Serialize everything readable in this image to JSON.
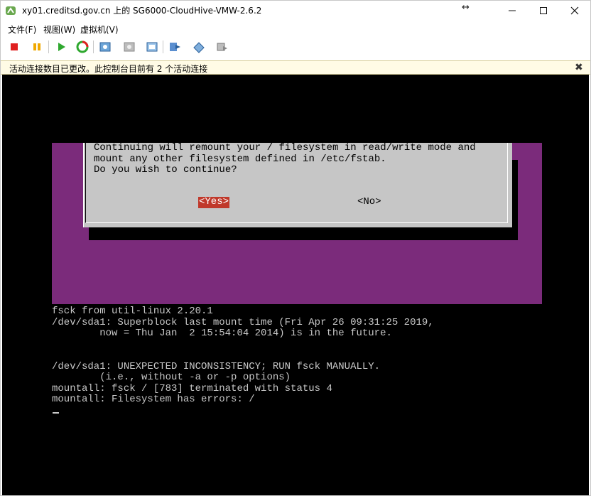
{
  "window": {
    "title": "xy01.creditsd.gov.cn 上的 SG6000-CloudHive-VMW-2.6.2",
    "resize_symbol": "↔",
    "min_symbol": "—",
    "max_symbol": "☐",
    "close_symbol": "✕"
  },
  "menu": {
    "items": [
      "文件(F)",
      "视图(W)",
      "虚拟机(V)"
    ]
  },
  "toolbar": {
    "icons": [
      "stop-icon",
      "pause-icon",
      "play-icon",
      "reset-icon",
      "snapshot-icon",
      "revert-snapshot-icon",
      "manage-snapshot-icon",
      "send-ctrl-alt-del-icon",
      "connect-device-icon",
      "settings-icon"
    ]
  },
  "notification": {
    "text": "活动连接数目已更改。此控制台目前有 2 个活动连接",
    "close_symbol": "✖"
  },
  "dialog": {
    "lines": [
      "Continuing will remount your / filesystem in read/write mode and",
      "mount any other filesystem defined in /etc/fstab.",
      "Do you wish to continue?"
    ],
    "yes_label": "<Yes>",
    "no_label": "<No>"
  },
  "terminal": {
    "lines": [
      "fsck from util-linux 2.20.1",
      "/dev/sda1: Superblock last mount time (Fri Apr 26 09:31:25 2019,",
      "        now = Thu Jan  2 15:54:04 2014) is in the future.",
      "",
      "",
      "/dev/sda1: UNEXPECTED INCONSISTENCY; RUN fsck MANUALLY.",
      "        (i.e., without -a or -p options)",
      "mountall: fsck / [783] terminated with status 4",
      "mountall: Filesystem has errors: /"
    ]
  },
  "colors": {
    "console_bg": "#000000",
    "purple_bg": "#7b2b7b",
    "dialog_bg": "#c6c6c6",
    "yes_highlight": "#c0392b",
    "notify_bg": "#fffbe5"
  }
}
